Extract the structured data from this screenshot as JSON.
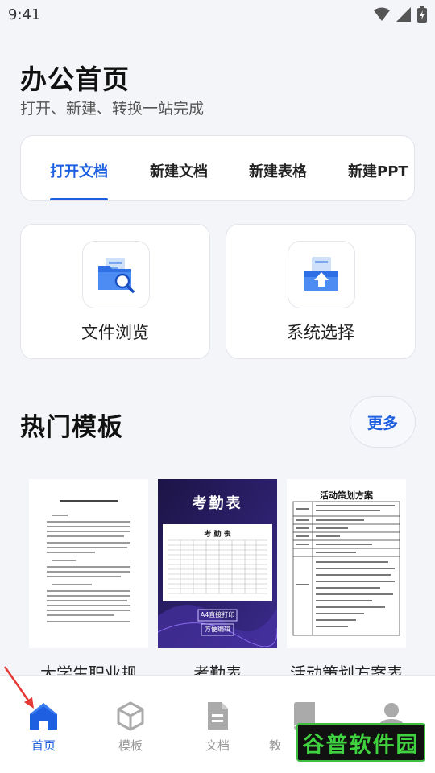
{
  "status": {
    "time": "9:41"
  },
  "header": {
    "title": "办公首页",
    "subtitle": "打开、新建、转换一站完成"
  },
  "tabs": [
    {
      "label": "打开文档",
      "active": true
    },
    {
      "label": "新建文档",
      "active": false
    },
    {
      "label": "新建表格",
      "active": false
    },
    {
      "label": "新建PPT",
      "active": false
    }
  ],
  "actions": [
    {
      "label": "文件浏览",
      "icon": "folder-search-icon"
    },
    {
      "label": "系统选择",
      "icon": "file-upload-icon"
    }
  ],
  "templates_section": {
    "title": "热门模板",
    "more_label": "更多"
  },
  "templates": [
    {
      "name": "大学生职业规"
    },
    {
      "name": "考勤表",
      "thumb_title": "考勤表",
      "thumb_sheet_title": "考 勤 表",
      "thumb_tag1": "A4直接打印",
      "thumb_tag2": "方便编辑"
    },
    {
      "name": "活动策划方案表",
      "thumb_title": "活动策划方案"
    }
  ],
  "nav": [
    {
      "label": "首页",
      "icon": "home-icon",
      "active": true
    },
    {
      "label": "模板",
      "icon": "cube-icon",
      "active": false
    },
    {
      "label": "文档",
      "icon": "document-icon",
      "active": false
    },
    {
      "label": "教",
      "icon": "book-icon",
      "active": false
    },
    {
      "label": "",
      "icon": "profile-icon",
      "active": false
    }
  ],
  "watermark": {
    "text": "谷普软件园"
  },
  "colors": {
    "accent": "#1d5fe0",
    "background": "#f4f5f9"
  }
}
